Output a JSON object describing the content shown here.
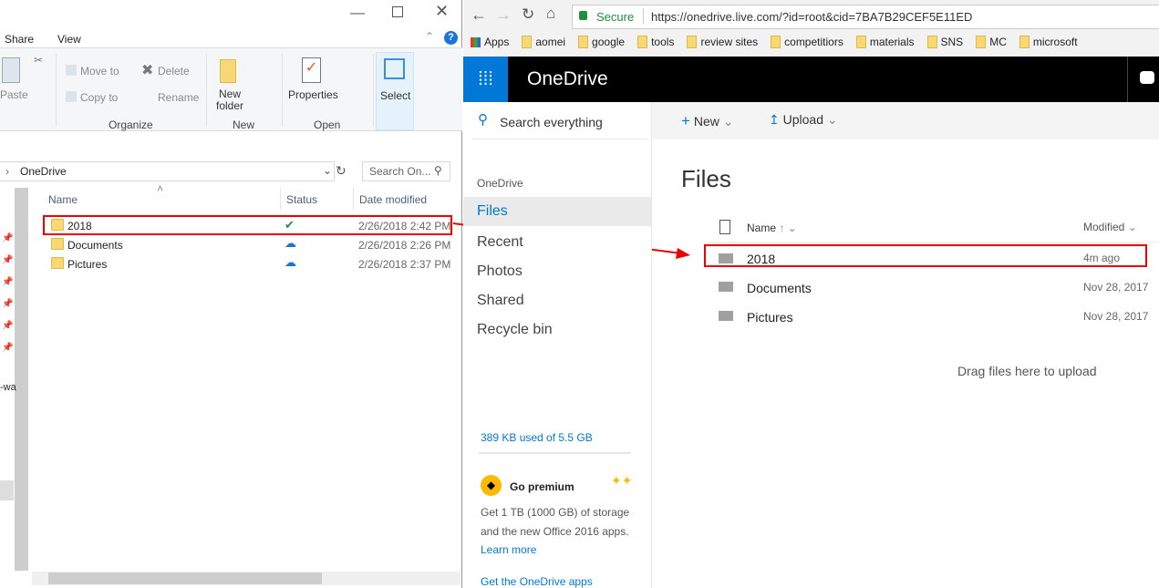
{
  "explorer": {
    "tabs": [
      "Share",
      "View"
    ],
    "ribbon": {
      "paste": "Paste",
      "move_to": "Move to",
      "copy_to": "Copy to",
      "delete": "Delete",
      "rename": "Rename",
      "organize": "Organize",
      "new_folder": "New folder",
      "new": "New",
      "properties": "Properties",
      "open": "Open",
      "select": "Select"
    },
    "address": "OneDrive",
    "search_placeholder": "Search On...",
    "columns": {
      "name": "Name",
      "status": "Status",
      "date": "Date modified"
    },
    "files": [
      {
        "name": "2018",
        "status": "synced",
        "date": "2/26/2018 2:42 PM"
      },
      {
        "name": "Documents",
        "status": "cloud",
        "date": "2/26/2018 2:26 PM"
      },
      {
        "name": "Pictures",
        "status": "cloud",
        "date": "2/26/2018 2:37 PM"
      }
    ],
    "nav_fragment": "-wa"
  },
  "browser": {
    "secure": "Secure",
    "url": "https://onedrive.live.com/?id=root&cid=7BA7B29CEF5E11ED",
    "bookmarks": [
      "Apps",
      "aomei",
      "google",
      "tools",
      "review sites",
      "competitiors",
      "materials",
      "SNS",
      "MC",
      "microsoft"
    ],
    "app_title": "OneDrive",
    "search": "Search everything",
    "toolbar": {
      "new": "New",
      "upload": "Upload"
    },
    "nav_heading": "OneDrive",
    "nav": [
      "Files",
      "Recent",
      "Photos",
      "Shared",
      "Recycle bin"
    ],
    "storage": "389 KB used of 5.5 GB",
    "premium": {
      "title": "Go premium",
      "text1": "Get 1 TB (1000 GB) of storage",
      "text2": "and the new Office 2016 apps.",
      "learn": "Learn more"
    },
    "get_apps": "Get the OneDrive apps",
    "page_title": "Files",
    "columns": {
      "name": "Name",
      "modified": "Modified"
    },
    "files": [
      {
        "name": "2018",
        "modified": "4m ago"
      },
      {
        "name": "Documents",
        "modified": "Nov 28, 2017"
      },
      {
        "name": "Pictures",
        "modified": "Nov 28, 2017"
      }
    ],
    "drag_hint": "Drag files here to upload"
  }
}
